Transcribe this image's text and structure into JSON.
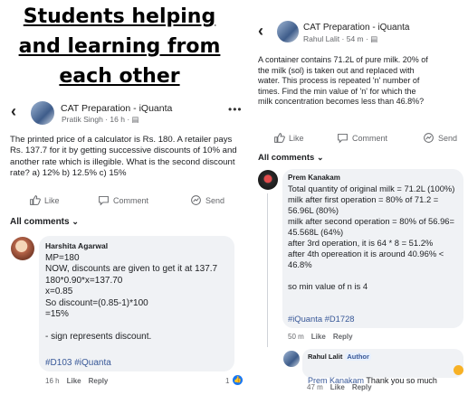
{
  "headline": {
    "line1": "Students helping",
    "line2": "and learning from",
    "line3": "each other"
  },
  "left": {
    "group_name": "CAT Preparation - iQuanta",
    "author": "Pratik Singh",
    "time": "16 h",
    "post_text": "The printed price of a calculator is Rs. 180. A retailer pays Rs. 137.7 for it by  getting successive discounts of 10% and another rate which is illegible. What is the second discount rate? a) 12% b) 12.5% c) 15%",
    "actions": {
      "like": "Like",
      "comment": "Comment",
      "send": "Send"
    },
    "all_comments": "All comments",
    "comment": {
      "name": "Harshita Agarwal",
      "body": "MP=180\nNOW, discounts are given to get it at 137.7\n180*0.90*x=137.70\nx=0.85\nSo discount=(0.85-1)*100\n=15%\n\n- sign represents discount.",
      "tags": "#D103 #iQuanta",
      "time": "16 h",
      "like": "Like",
      "reply": "Reply",
      "reactions": "1"
    }
  },
  "right": {
    "group_name": "CAT Preparation - iQuanta",
    "author": "Rahul Lalit",
    "time": "54 m",
    "post_text": "A container contains 71.2L of pure milk. 20% of the milk (sol) is taken out and replaced with water. This process is repeated 'n' number of times. Find the min value of 'n' for which the milk concentration becomes less than 46.8%?",
    "actions": {
      "like": "Like",
      "comment": "Comment",
      "send": "Send"
    },
    "all_comments": "All comments",
    "comment": {
      "name": "Prem Kanakam",
      "body": "Total quantity of original milk = 71.2L (100%)\nmilk after first operation = 80% of 71.2 = 56.96L (80%)\nmilk after second operation = 80% of 56.96= 45.568L  (64%)\nafter 3rd operation, it is 64 * 8 = 51.2%\nafter 4th opereation it is around 40.96% < 46.8%\n\nso min value of n is 4",
      "tags": "#iQuanta #D1728",
      "time": "50 m",
      "like": "Like",
      "reply": "Reply"
    },
    "reply": {
      "name": "Rahul Lalit",
      "badge": "Author",
      "mention": "Prem Kanakam",
      "text": " Thank you so much",
      "time": "47 m",
      "like": "Like",
      "reply": "Reply"
    }
  }
}
